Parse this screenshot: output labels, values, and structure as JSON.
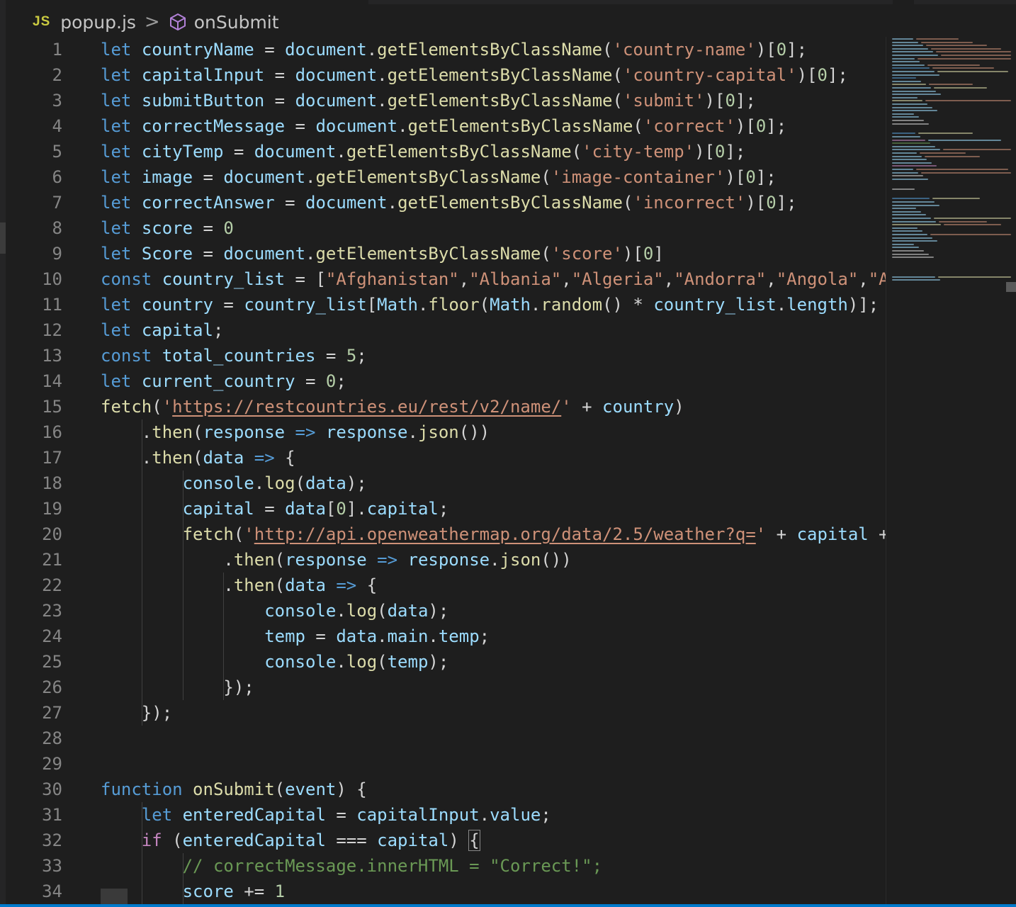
{
  "breadcrumb": {
    "lang_badge": "JS",
    "file": "popup.js",
    "separator": ">",
    "symbol": "onSubmit"
  },
  "editor": {
    "line_numbers": [
      "1",
      "2",
      "3",
      "4",
      "5",
      "6",
      "7",
      "8",
      "9",
      "10",
      "11",
      "12",
      "13",
      "14",
      "15",
      "16",
      "17",
      "18",
      "19",
      "20",
      "21",
      "22",
      "23",
      "24",
      "25",
      "26",
      "27",
      "28",
      "29",
      "30",
      "31",
      "32",
      "33",
      "34"
    ],
    "lines": [
      [
        [
          "k",
          "let"
        ],
        [
          "p",
          " "
        ],
        [
          "v",
          "countryName"
        ],
        [
          "p",
          " = "
        ],
        [
          "v",
          "document"
        ],
        [
          "p",
          "."
        ],
        [
          "f",
          "getElementsByClassName"
        ],
        [
          "p",
          "("
        ],
        [
          "s",
          "'country-name'"
        ],
        [
          "p",
          ")["
        ],
        [
          "n",
          "0"
        ],
        [
          "p",
          "];"
        ]
      ],
      [
        [
          "k",
          "let"
        ],
        [
          "p",
          " "
        ],
        [
          "v",
          "capitalInput"
        ],
        [
          "p",
          " = "
        ],
        [
          "v",
          "document"
        ],
        [
          "p",
          "."
        ],
        [
          "f",
          "getElementsByClassName"
        ],
        [
          "p",
          "("
        ],
        [
          "s",
          "'country-capital'"
        ],
        [
          "p",
          ")["
        ],
        [
          "n",
          "0"
        ],
        [
          "p",
          "];"
        ]
      ],
      [
        [
          "k",
          "let"
        ],
        [
          "p",
          " "
        ],
        [
          "v",
          "submitButton"
        ],
        [
          "p",
          " = "
        ],
        [
          "v",
          "document"
        ],
        [
          "p",
          "."
        ],
        [
          "f",
          "getElementsByClassName"
        ],
        [
          "p",
          "("
        ],
        [
          "s",
          "'submit'"
        ],
        [
          "p",
          ")["
        ],
        [
          "n",
          "0"
        ],
        [
          "p",
          "];"
        ]
      ],
      [
        [
          "k",
          "let"
        ],
        [
          "p",
          " "
        ],
        [
          "v",
          "correctMessage"
        ],
        [
          "p",
          " = "
        ],
        [
          "v",
          "document"
        ],
        [
          "p",
          "."
        ],
        [
          "f",
          "getElementsByClassName"
        ],
        [
          "p",
          "("
        ],
        [
          "s",
          "'correct'"
        ],
        [
          "p",
          ")["
        ],
        [
          "n",
          "0"
        ],
        [
          "p",
          "];"
        ]
      ],
      [
        [
          "k",
          "let"
        ],
        [
          "p",
          " "
        ],
        [
          "v",
          "cityTemp"
        ],
        [
          "p",
          " = "
        ],
        [
          "v",
          "document"
        ],
        [
          "p",
          "."
        ],
        [
          "f",
          "getElementsByClassName"
        ],
        [
          "p",
          "("
        ],
        [
          "s",
          "'city-temp'"
        ],
        [
          "p",
          ")["
        ],
        [
          "n",
          "0"
        ],
        [
          "p",
          "];"
        ]
      ],
      [
        [
          "k",
          "let"
        ],
        [
          "p",
          " "
        ],
        [
          "v",
          "image"
        ],
        [
          "p",
          " = "
        ],
        [
          "v",
          "document"
        ],
        [
          "p",
          "."
        ],
        [
          "f",
          "getElementsByClassName"
        ],
        [
          "p",
          "("
        ],
        [
          "s",
          "'image-container'"
        ],
        [
          "p",
          ")["
        ],
        [
          "n",
          "0"
        ],
        [
          "p",
          "];"
        ]
      ],
      [
        [
          "k",
          "let"
        ],
        [
          "p",
          " "
        ],
        [
          "v",
          "correctAnswer"
        ],
        [
          "p",
          " = "
        ],
        [
          "v",
          "document"
        ],
        [
          "p",
          "."
        ],
        [
          "f",
          "getElementsByClassName"
        ],
        [
          "p",
          "("
        ],
        [
          "s",
          "'incorrect'"
        ],
        [
          "p",
          ")["
        ],
        [
          "n",
          "0"
        ],
        [
          "p",
          "];"
        ]
      ],
      [
        [
          "k",
          "let"
        ],
        [
          "p",
          " "
        ],
        [
          "v",
          "score"
        ],
        [
          "p",
          " = "
        ],
        [
          "n",
          "0"
        ]
      ],
      [
        [
          "k",
          "let"
        ],
        [
          "p",
          " "
        ],
        [
          "v",
          "Score"
        ],
        [
          "p",
          " = "
        ],
        [
          "v",
          "document"
        ],
        [
          "p",
          "."
        ],
        [
          "f",
          "getElementsByClassName"
        ],
        [
          "p",
          "("
        ],
        [
          "s",
          "'score'"
        ],
        [
          "p",
          ")["
        ],
        [
          "n",
          "0"
        ],
        [
          "p",
          "]"
        ]
      ],
      [
        [
          "k",
          "const"
        ],
        [
          "p",
          " "
        ],
        [
          "v",
          "country_list"
        ],
        [
          "p",
          " = ["
        ],
        [
          "s",
          "\"Afghanistan\""
        ],
        [
          "p",
          ","
        ],
        [
          "s",
          "\"Albania\""
        ],
        [
          "p",
          ","
        ],
        [
          "s",
          "\"Algeria\""
        ],
        [
          "p",
          ","
        ],
        [
          "s",
          "\"Andorra\""
        ],
        [
          "p",
          ","
        ],
        [
          "s",
          "\"Angola\""
        ],
        [
          "p",
          ","
        ],
        [
          "s",
          "\"A"
        ]
      ],
      [
        [
          "k",
          "let"
        ],
        [
          "p",
          " "
        ],
        [
          "v",
          "country"
        ],
        [
          "p",
          " = "
        ],
        [
          "v",
          "country_list"
        ],
        [
          "p",
          "["
        ],
        [
          "v",
          "Math"
        ],
        [
          "p",
          "."
        ],
        [
          "f",
          "floor"
        ],
        [
          "p",
          "("
        ],
        [
          "v",
          "Math"
        ],
        [
          "p",
          "."
        ],
        [
          "f",
          "random"
        ],
        [
          "p",
          "() * "
        ],
        [
          "v",
          "country_list"
        ],
        [
          "p",
          "."
        ],
        [
          "v",
          "length"
        ],
        [
          "p",
          ")];"
        ]
      ],
      [
        [
          "k",
          "let"
        ],
        [
          "p",
          " "
        ],
        [
          "v",
          "capital"
        ],
        [
          "p",
          ";"
        ]
      ],
      [
        [
          "k",
          "const"
        ],
        [
          "p",
          " "
        ],
        [
          "v",
          "total_countries"
        ],
        [
          "p",
          " = "
        ],
        [
          "n",
          "5"
        ],
        [
          "p",
          ";"
        ]
      ],
      [
        [
          "k",
          "let"
        ],
        [
          "p",
          " "
        ],
        [
          "v",
          "current_country"
        ],
        [
          "p",
          " = "
        ],
        [
          "n",
          "0"
        ],
        [
          "p",
          ";"
        ]
      ],
      [
        [
          "f",
          "fetch"
        ],
        [
          "p",
          "("
        ],
        [
          "s",
          "'"
        ],
        [
          "su",
          "https://restcountries.eu/rest/v2/name/"
        ],
        [
          "s",
          "'"
        ],
        [
          "p",
          " + "
        ],
        [
          "v",
          "country"
        ],
        [
          "p",
          ")"
        ]
      ],
      [
        [
          "p",
          "    ."
        ],
        [
          "f",
          "then"
        ],
        [
          "p",
          "("
        ],
        [
          "v",
          "response"
        ],
        [
          "p",
          " "
        ],
        [
          "k",
          "=>"
        ],
        [
          "p",
          " "
        ],
        [
          "v",
          "response"
        ],
        [
          "p",
          "."
        ],
        [
          "f",
          "json"
        ],
        [
          "p",
          "())"
        ]
      ],
      [
        [
          "p",
          "    ."
        ],
        [
          "f",
          "then"
        ],
        [
          "p",
          "("
        ],
        [
          "v",
          "data"
        ],
        [
          "p",
          " "
        ],
        [
          "k",
          "=>"
        ],
        [
          "p",
          " {"
        ]
      ],
      [
        [
          "p",
          "        "
        ],
        [
          "v",
          "console"
        ],
        [
          "p",
          "."
        ],
        [
          "f",
          "log"
        ],
        [
          "p",
          "("
        ],
        [
          "v",
          "data"
        ],
        [
          "p",
          ");"
        ]
      ],
      [
        [
          "p",
          "        "
        ],
        [
          "v",
          "capital"
        ],
        [
          "p",
          " = "
        ],
        [
          "v",
          "data"
        ],
        [
          "p",
          "["
        ],
        [
          "n",
          "0"
        ],
        [
          "p",
          "]."
        ],
        [
          "v",
          "capital"
        ],
        [
          "p",
          ";"
        ]
      ],
      [
        [
          "p",
          "        "
        ],
        [
          "f",
          "fetch"
        ],
        [
          "p",
          "("
        ],
        [
          "s",
          "'"
        ],
        [
          "su",
          "http://api.openweathermap.org/data/2.5/weather?q="
        ],
        [
          "s",
          "'"
        ],
        [
          "p",
          " + "
        ],
        [
          "v",
          "capital"
        ],
        [
          "p",
          " +"
        ]
      ],
      [
        [
          "p",
          "            ."
        ],
        [
          "f",
          "then"
        ],
        [
          "p",
          "("
        ],
        [
          "v",
          "response"
        ],
        [
          "p",
          " "
        ],
        [
          "k",
          "=>"
        ],
        [
          "p",
          " "
        ],
        [
          "v",
          "response"
        ],
        [
          "p",
          "."
        ],
        [
          "f",
          "json"
        ],
        [
          "p",
          "())"
        ]
      ],
      [
        [
          "p",
          "            ."
        ],
        [
          "f",
          "then"
        ],
        [
          "p",
          "("
        ],
        [
          "v",
          "data"
        ],
        [
          "p",
          " "
        ],
        [
          "k",
          "=>"
        ],
        [
          "p",
          " {"
        ]
      ],
      [
        [
          "p",
          "                "
        ],
        [
          "v",
          "console"
        ],
        [
          "p",
          "."
        ],
        [
          "f",
          "log"
        ],
        [
          "p",
          "("
        ],
        [
          "v",
          "data"
        ],
        [
          "p",
          ");"
        ]
      ],
      [
        [
          "p",
          "                "
        ],
        [
          "v",
          "temp"
        ],
        [
          "p",
          " = "
        ],
        [
          "v",
          "data"
        ],
        [
          "p",
          "."
        ],
        [
          "v",
          "main"
        ],
        [
          "p",
          "."
        ],
        [
          "v",
          "temp"
        ],
        [
          "p",
          ";"
        ]
      ],
      [
        [
          "p",
          "                "
        ],
        [
          "v",
          "console"
        ],
        [
          "p",
          "."
        ],
        [
          "f",
          "log"
        ],
        [
          "p",
          "("
        ],
        [
          "v",
          "temp"
        ],
        [
          "p",
          ");"
        ]
      ],
      [
        [
          "p",
          "            });"
        ]
      ],
      [
        [
          "p",
          "    });"
        ]
      ],
      [],
      [],
      [
        [
          "k",
          "function"
        ],
        [
          "p",
          " "
        ],
        [
          "f",
          "onSubmit"
        ],
        [
          "p",
          "("
        ],
        [
          "v",
          "event"
        ],
        [
          "p",
          ") {"
        ]
      ],
      [
        [
          "p",
          "    "
        ],
        [
          "k",
          "let"
        ],
        [
          "p",
          " "
        ],
        [
          "v",
          "enteredCapital"
        ],
        [
          "p",
          " = "
        ],
        [
          "v",
          "capitalInput"
        ],
        [
          "p",
          "."
        ],
        [
          "v",
          "value"
        ],
        [
          "p",
          ";"
        ]
      ],
      [
        [
          "p",
          "    "
        ],
        [
          "ck",
          "if"
        ],
        [
          "p",
          " ("
        ],
        [
          "v",
          "enteredCapital"
        ],
        [
          "p",
          " === "
        ],
        [
          "v",
          "capital"
        ],
        [
          "p",
          ") "
        ],
        [
          "pb",
          "{"
        ]
      ],
      [
        [
          "p",
          "        "
        ],
        [
          "c",
          "// correctMessage.innerHTML = \"Correct!\";"
        ]
      ],
      [
        [
          "p",
          "        "
        ],
        [
          "v",
          "score"
        ],
        [
          "p",
          " += "
        ],
        [
          "n",
          "1"
        ]
      ]
    ]
  },
  "minimap": {
    "lines": [
      [
        "#9cdcfe",
        "#ce9178"
      ],
      [
        "#9cdcfe",
        "#ce9178"
      ],
      [
        "#9cdcfe",
        "#ce9178"
      ],
      [
        "#9cdcfe",
        "#ce9178"
      ],
      [
        "#9cdcfe",
        "#ce9178"
      ],
      [
        "#9cdcfe",
        "#ce9178"
      ],
      [
        "#9cdcfe",
        "#ce9178"
      ],
      [
        "#9cdcfe"
      ],
      [
        "#9cdcfe",
        "#ce9178"
      ],
      [
        "#569cd6",
        "#ce9178"
      ],
      [
        "#9cdcfe",
        "#dcdcaa"
      ],
      [
        "#9cdcfe"
      ],
      [
        "#569cd6"
      ],
      [
        "#9cdcfe"
      ],
      [
        "#dcdcaa",
        "#ce9178"
      ],
      [
        "#9cdcfe",
        "#dcdcaa"
      ],
      [
        "#9cdcfe"
      ],
      [
        "#9cdcfe"
      ],
      [
        "#9cdcfe"
      ],
      [
        "#dcdcaa",
        "#ce9178"
      ],
      [
        "#9cdcfe"
      ],
      [
        "#9cdcfe"
      ],
      [
        "#9cdcfe"
      ],
      [
        "#9cdcfe"
      ],
      [
        "#9cdcfe"
      ],
      [
        "#d4d4d4"
      ],
      [
        "#d4d4d4"
      ],
      [],
      [],
      [
        "#569cd6",
        "#dcdcaa"
      ],
      [
        "#9cdcfe"
      ],
      [
        "#c586c0",
        "#9cdcfe"
      ],
      [
        "#6a9955"
      ],
      [
        "#9cdcfe"
      ],
      [
        "#9cdcfe",
        "#ce9178"
      ],
      [
        "#9cdcfe",
        "#ce9178"
      ],
      [
        "#9cdcfe",
        "#ce9178"
      ],
      [
        "#9cdcfe"
      ],
      [
        "#9cdcfe"
      ],
      [
        "#c586c0"
      ],
      [
        "#9cdcfe",
        "#ce9178"
      ],
      [
        "#9cdcfe",
        "#ce9178"
      ],
      [
        "#d4d4d4"
      ],
      [
        "#9cdcfe"
      ],
      [],
      [],
      [
        "#d4d4d4"
      ],
      [],
      [],
      [
        "#569cd6",
        "#dcdcaa"
      ],
      [
        "#9cdcfe"
      ],
      [
        "#9cdcfe"
      ],
      [
        "#9cdcfe"
      ],
      [
        "#9cdcfe"
      ],
      [
        "#9cdcfe"
      ],
      [
        "#9cdcfe",
        "#dcdcaa"
      ],
      [
        "#9cdcfe",
        "#ce9178"
      ],
      [
        "#dcdcaa",
        "#ce9178"
      ],
      [
        "#9cdcfe"
      ],
      [
        "#9cdcfe"
      ],
      [
        "#9cdcfe",
        "#ce9178"
      ],
      [
        "#9cdcfe"
      ],
      [
        "#9cdcfe"
      ],
      [
        "#9cdcfe"
      ],
      [
        "#9cdcfe"
      ],
      [
        "#d4d4d4"
      ],
      [
        "#d4d4d4"
      ],
      [
        "#d4d4d4"
      ],
      [],
      [],
      [],
      [],
      [],
      [
        "#9cdcfe",
        "#dcdcaa"
      ],
      [
        "#9cdcfe"
      ]
    ]
  }
}
